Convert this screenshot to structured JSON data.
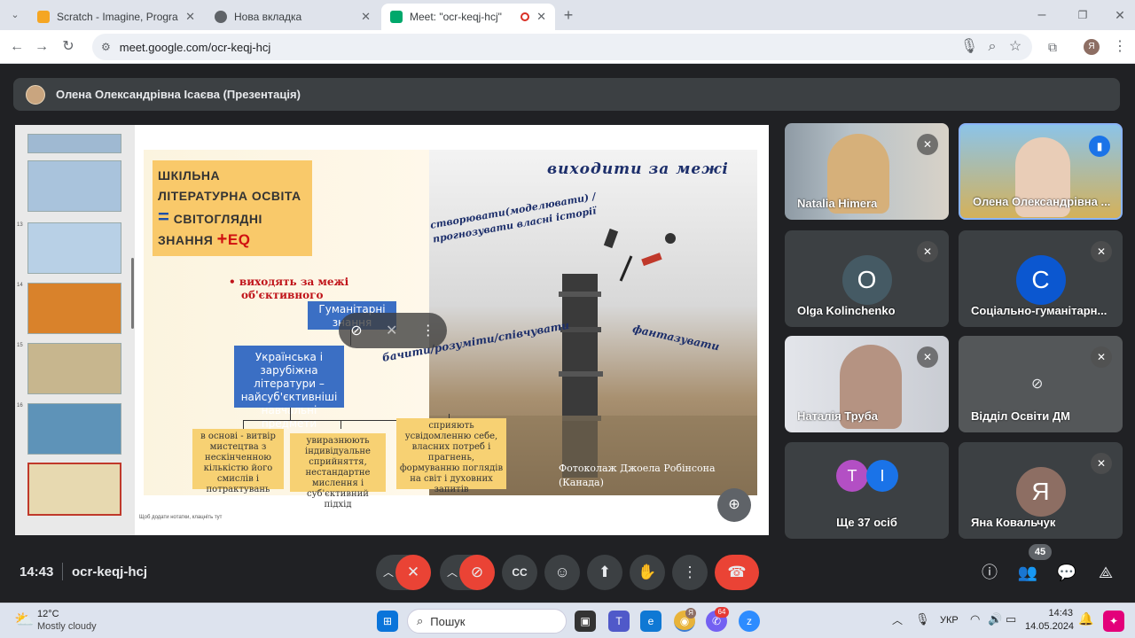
{
  "browser": {
    "tabs": [
      {
        "title": "Scratch - Imagine, Program, Sha",
        "color": "#f5a623"
      },
      {
        "title": "Нова вкладка",
        "color": "#5f6368"
      },
      {
        "title": "Meet: \"ocr-keqj-hcj\"",
        "color": "#00a86b"
      }
    ],
    "url": "meet.google.com/ocr-keqj-hcj",
    "profile_initial": "Я"
  },
  "presenter_bar": {
    "title": "Олена Олександрівна Ісаєва (Презентація)"
  },
  "thumbnails": [
    "13",
    "14",
    "15",
    "16"
  ],
  "slide": {
    "title_line1": "ШКІЛЬНА",
    "title_line2": "ЛІТЕРАТУРНА ОСВІТА",
    "title_eq": "=",
    "title_line3": "СВІТОГЛЯДНІ",
    "title_line4": "ЗНАННЯ",
    "title_plus": "+",
    "title_eq_word": "EQ",
    "bullet_line1": "виходять за межі",
    "bullet_line2": "об'єктивного",
    "humanities": "Гуманітарні знання",
    "literature": "Українська і зарубіжна літератури – найсуб'єктивніші навчальні предмети",
    "box1": "в основі - витвір мистецтва з нескінченною кількістю його смислів і потрактувань",
    "box2": "увиразнюють індивідуальне сприйняття, нестандартне мислення і суб'єктивний підхід",
    "box3": "сприяють усвідомленню себе, власних потреб і прагнень, формуванню поглядів на світ і духовних запитів",
    "phrase_beyond": "виходити за межі",
    "phrase_create": "створювати(моделювати) /прогнозувати власні історії",
    "phrase_see": "бачити/розуміти/співчувати",
    "phrase_fantasy": "фантазувати",
    "caption_line1": "Фотоколаж Джоела Робінсона",
    "caption_line2": "(Канада)",
    "footer_note": "Щоб додати нотатки, клацніть тут"
  },
  "participants": [
    {
      "name": "Natalia Himera",
      "type": "video",
      "muted": true
    },
    {
      "name": "Олена Олександрівна ...",
      "type": "video",
      "speaking": true
    },
    {
      "name": "Olga Kolinchenko",
      "initial": "O",
      "color": "#455a64",
      "muted": true
    },
    {
      "name": "Соціально-гуманітарн...",
      "initial": "С",
      "color": "#0b57d0",
      "muted": true
    },
    {
      "name": "Наталія Труба",
      "type": "video",
      "muted": true
    },
    {
      "name": "Відділ Освіти ДМ",
      "type": "camera-off",
      "muted": true
    },
    {
      "name": "Ще 37 осіб",
      "type": "more",
      "initials": [
        "T",
        "І"
      ]
    },
    {
      "name": "Яна Ковальчук",
      "initial": "Я",
      "color": "#8d6e63",
      "muted": true
    }
  ],
  "bottom": {
    "time": "14:43",
    "meeting_code": "ocr-keqj-hcj",
    "people_count": "45"
  },
  "taskbar": {
    "weather_temp": "12°C",
    "weather_desc": "Mostly cloudy",
    "search_placeholder": "Пошук",
    "lang": "УКР",
    "time": "14:43",
    "date": "14.05.2024",
    "chrome_badge": "Я",
    "viber_badge": "64"
  }
}
